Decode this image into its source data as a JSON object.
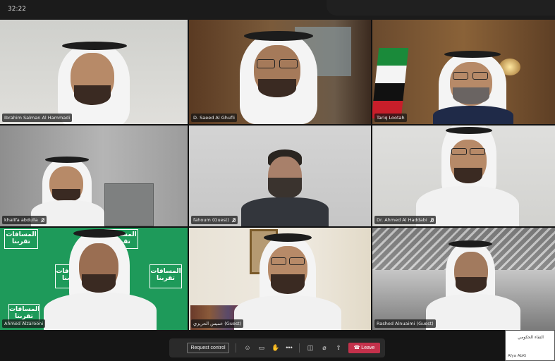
{
  "status_bar": {
    "time": "32:22"
  },
  "participants": [
    {
      "name": "Ibrahim Salman Al Hammadi",
      "muted": false
    },
    {
      "name": "D. Saeed Al Ghufli",
      "muted": false
    },
    {
      "name": "Tariq Lootah",
      "muted": false
    },
    {
      "name": "khalifa abdulla",
      "muted": true
    },
    {
      "name": "fahoum (Guest)",
      "muted": true
    },
    {
      "name": "Dr. Ahmed Al Haddabi",
      "muted": true
    },
    {
      "name": "Ahmed Alzarooni",
      "muted": false
    },
    {
      "name": "خميس الحريزي (Guest)",
      "muted": false
    },
    {
      "name": "Rashed Alnuaimi (Guest)",
      "muted": false
    }
  ],
  "green_backdrop": {
    "slogan": "المسافات تقربنا",
    "color": "#1e9a5a"
  },
  "toolbar": {
    "request_control": "Request control",
    "icons": [
      "reactions-icon",
      "chat-icon",
      "raise-hand-icon",
      "more-icon",
      "camera-off-icon",
      "mic-off-icon",
      "share-icon"
    ],
    "leave": "Leave",
    "leave_color": "#c4314b"
  },
  "self_view": {
    "logo_text": "التقاء الحكومي",
    "name": "Afya AbKi"
  }
}
